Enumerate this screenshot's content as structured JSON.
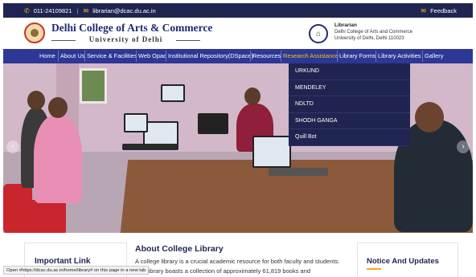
{
  "topbar": {
    "phone": "011-24109821",
    "email": "librarian@dcac.du.ac.in",
    "feedback": "Feedback"
  },
  "header": {
    "college_name": "Delhi College of Arts & Commerce",
    "university": "University of Delhi",
    "librarian_title": "Librarian",
    "librarian_line1": "Delhi College of Arts and Commerce",
    "librarian_line2": "University of Delhi, Delhi 110023"
  },
  "nav": {
    "items": [
      {
        "label": "Home"
      },
      {
        "label": "About Us"
      },
      {
        "label": "Service & Facilities"
      },
      {
        "label": "Web Opac"
      },
      {
        "label": "Institutional Repository(DSpace)"
      },
      {
        "label": "Resources"
      },
      {
        "label": "Research Assistance"
      },
      {
        "label": "Library Forms"
      },
      {
        "label": "Library Activities"
      },
      {
        "label": "Gallery"
      }
    ],
    "active_index": 6
  },
  "dropdown": {
    "items": [
      "URKUND",
      "MENDELEY",
      "NDLTD",
      "SHODH GANGA",
      "Quill Bot"
    ]
  },
  "content": {
    "important_link": "Important Link",
    "about_title": "About College Library",
    "about_line1": "A college library is a crucial academic resource for both faculty and students.",
    "about_line2": "The library boasts a collection of approximately 61,819 books and",
    "notice_title": "Notice And Updates"
  },
  "status_tip": "Open #https://dcac.du.ac.in/home/library# on this page in a new tab",
  "colors": {
    "navy": "#1f2550",
    "nav_blue": "#2d3795",
    "accent_yellow": "#f5c518"
  },
  "icons": {
    "phone": "phone-icon",
    "email": "envelope-icon",
    "feedback": "envelope-icon",
    "home": "home-icon",
    "prev": "chevron-left-icon",
    "next": "chevron-right-icon"
  }
}
